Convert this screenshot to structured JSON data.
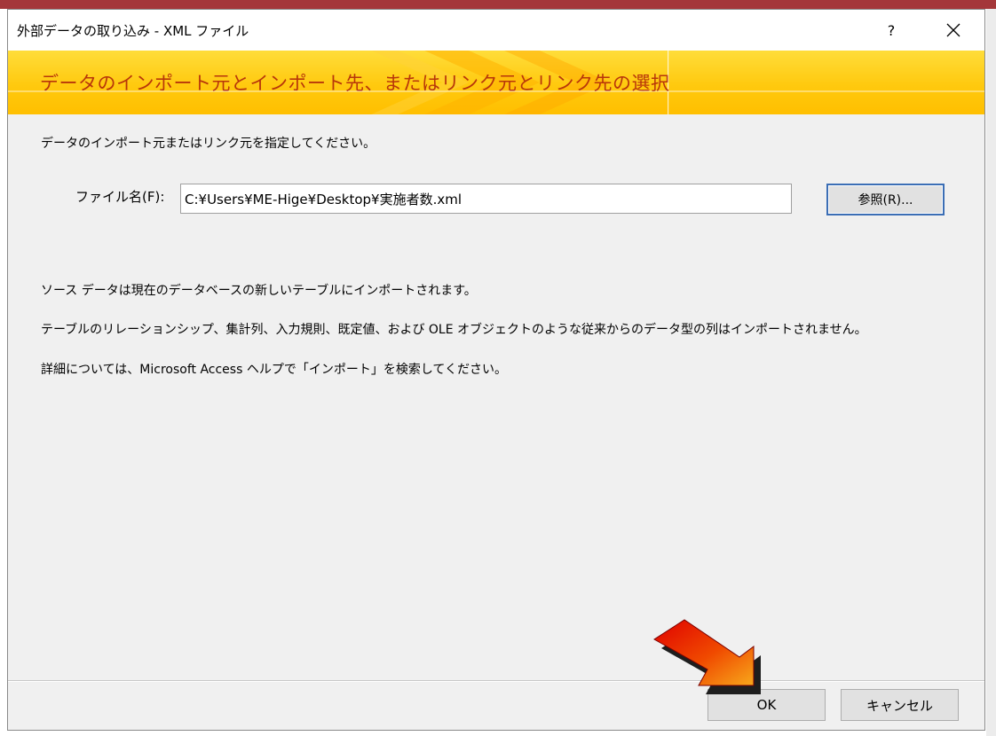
{
  "window": {
    "title": "外部データの取り込み - XML ファイル",
    "help_label": "?"
  },
  "banner": {
    "heading": "データのインポート元とインポート先、またはリンク元とリンク先の選択"
  },
  "main": {
    "instruction": "データのインポート元またはリンク元を指定してください。",
    "file_label": "ファイル名(F):",
    "file_value": "C:¥Users¥ME-Hige¥Desktop¥実施者数.xml",
    "browse_label": "参照(R)...",
    "info_lines": [
      "ソース データは現在のデータベースの新しいテーブルにインポートされます。",
      "テーブルのリレーションシップ、集計列、入力規則、既定値、および OLE オブジェクトのような従来からのデータ型の列はインポートされません。",
      "詳細については、Microsoft Access ヘルプで「インポート」を検索してください。"
    ]
  },
  "footer": {
    "ok_label": "OK",
    "cancel_label": "キャンセル"
  },
  "colors": {
    "banner_yellow": "#ffc90e",
    "banner_text": "#b8360a",
    "accent_border": "#3b6eb5",
    "title_strip": "#a4373a",
    "arrow_red": "#e00000",
    "arrow_orange": "#f7a81b"
  },
  "icons": {
    "close": "close-icon",
    "annotation": "pointer-arrow-icon"
  }
}
